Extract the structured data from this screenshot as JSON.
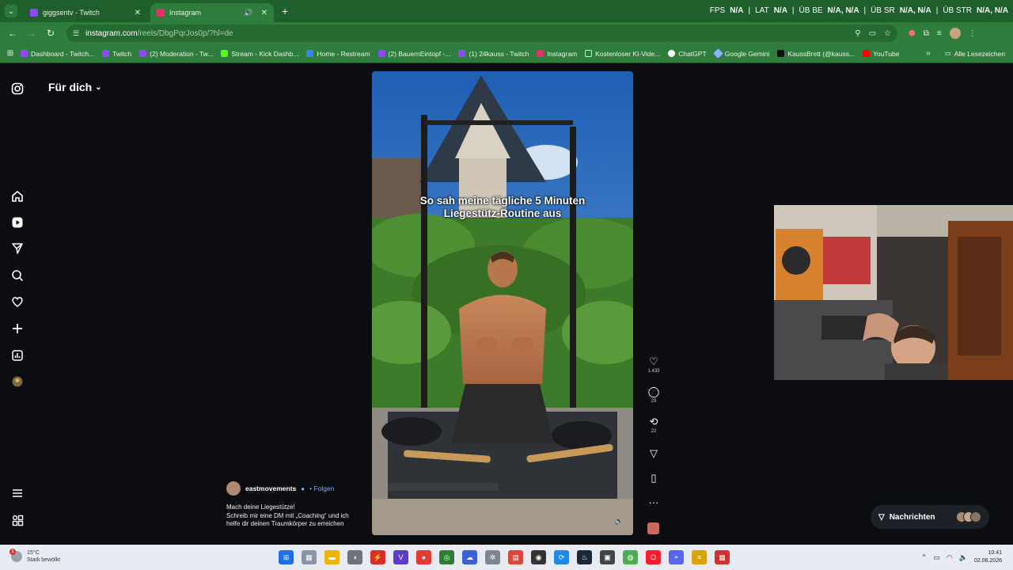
{
  "browser": {
    "tabs": [
      {
        "title": "giggsentv - Twitch",
        "favicon_color": "#9146ff"
      },
      {
        "title": "Instagram",
        "favicon_color": "#e1306c",
        "active": true
      }
    ],
    "stats": {
      "fps_label": "FPS",
      "fps_value": "N/A",
      "lat_label": "LAT",
      "lat_value": "N/A",
      "ub_be_label": "ÜB BE",
      "ub_be_value": "N/A, N/A",
      "ub_sr_label": "ÜB SR",
      "ub_sr_value": "N/A, N/A",
      "ub_str_label": "ÜB STR",
      "ub_str_value": "N/A, N/A"
    },
    "url_main": "instagram.com",
    "url_rest": "/reels/DbgPqrJos0p/?hl=de",
    "bookmarks": [
      {
        "label": "Dashboard - Twitch...",
        "color": "#9146ff"
      },
      {
        "label": "Twitch",
        "color": "#9146ff"
      },
      {
        "label": "(2) Moderation - Tw...",
        "color": "#9146ff"
      },
      {
        "label": "Stream - Kick Dashb...",
        "color": "#53fc18"
      },
      {
        "label": "Home - Restream",
        "color": "#3b82f6"
      },
      {
        "label": "(2) BauernEintopf -...",
        "color": "#9146ff"
      },
      {
        "label": "(1) 24kauss - Twitch",
        "color": "#9146ff"
      },
      {
        "label": "Instagram",
        "color": "#e1306c"
      },
      {
        "label": "Kostenloser KI-Vide...",
        "color": "#2e7d3c"
      },
      {
        "label": "ChatGPT",
        "color": "#ffffff"
      },
      {
        "label": "Google Gemini",
        "color": "#8ab4f8"
      },
      {
        "label": "KaussBrett (@kauss...",
        "color": "#111111"
      },
      {
        "label": "YouTube",
        "color": "#ff0000"
      }
    ],
    "bookmarks_all": "Alle Lesezeichen"
  },
  "instagram": {
    "feed_title": "Für dich",
    "video_caption_line1": "So sah meine tägliche 5 Minuten",
    "video_caption_line2": "Liegestütz-Routine aus",
    "likes": "1.433",
    "comments": "29",
    "reposts": "22",
    "username": "eastmovements",
    "follow": "Folgen",
    "desc_line1": "Mach deine Liegestütze!",
    "desc_line2": "Schreib mir eine DM mit „Coaching“ und ich",
    "desc_line3": "helfe dir deinen Traumkörper zu erreichen",
    "messages_label": "Nachrichten"
  },
  "taskbar": {
    "temp": "15°C",
    "weather": "Stark bewölkt",
    "time": "10:41",
    "date": "02.08.2026"
  }
}
